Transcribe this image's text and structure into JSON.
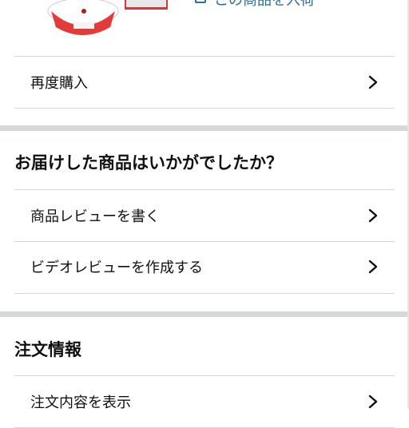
{
  "order_item": {
    "buy_again_link": "この商品を入荷",
    "product_icon": "cotton-candy-machine"
  },
  "actions": {
    "rebuy_label": "再度購入"
  },
  "review_section": {
    "title": "お届けした商品はいかがでしたか？",
    "write_review_label": "商品レビューを書く",
    "video_review_label": "ビデオレビューを作成する"
  },
  "order_info_section": {
    "title": "注文情報",
    "view_order_label": "注文内容を表示"
  },
  "icons": {
    "chevron": "chevron-right-icon"
  },
  "colors": {
    "link": "#2a6f9b",
    "divider": "#d5d9d9",
    "text": "#0f1111"
  }
}
